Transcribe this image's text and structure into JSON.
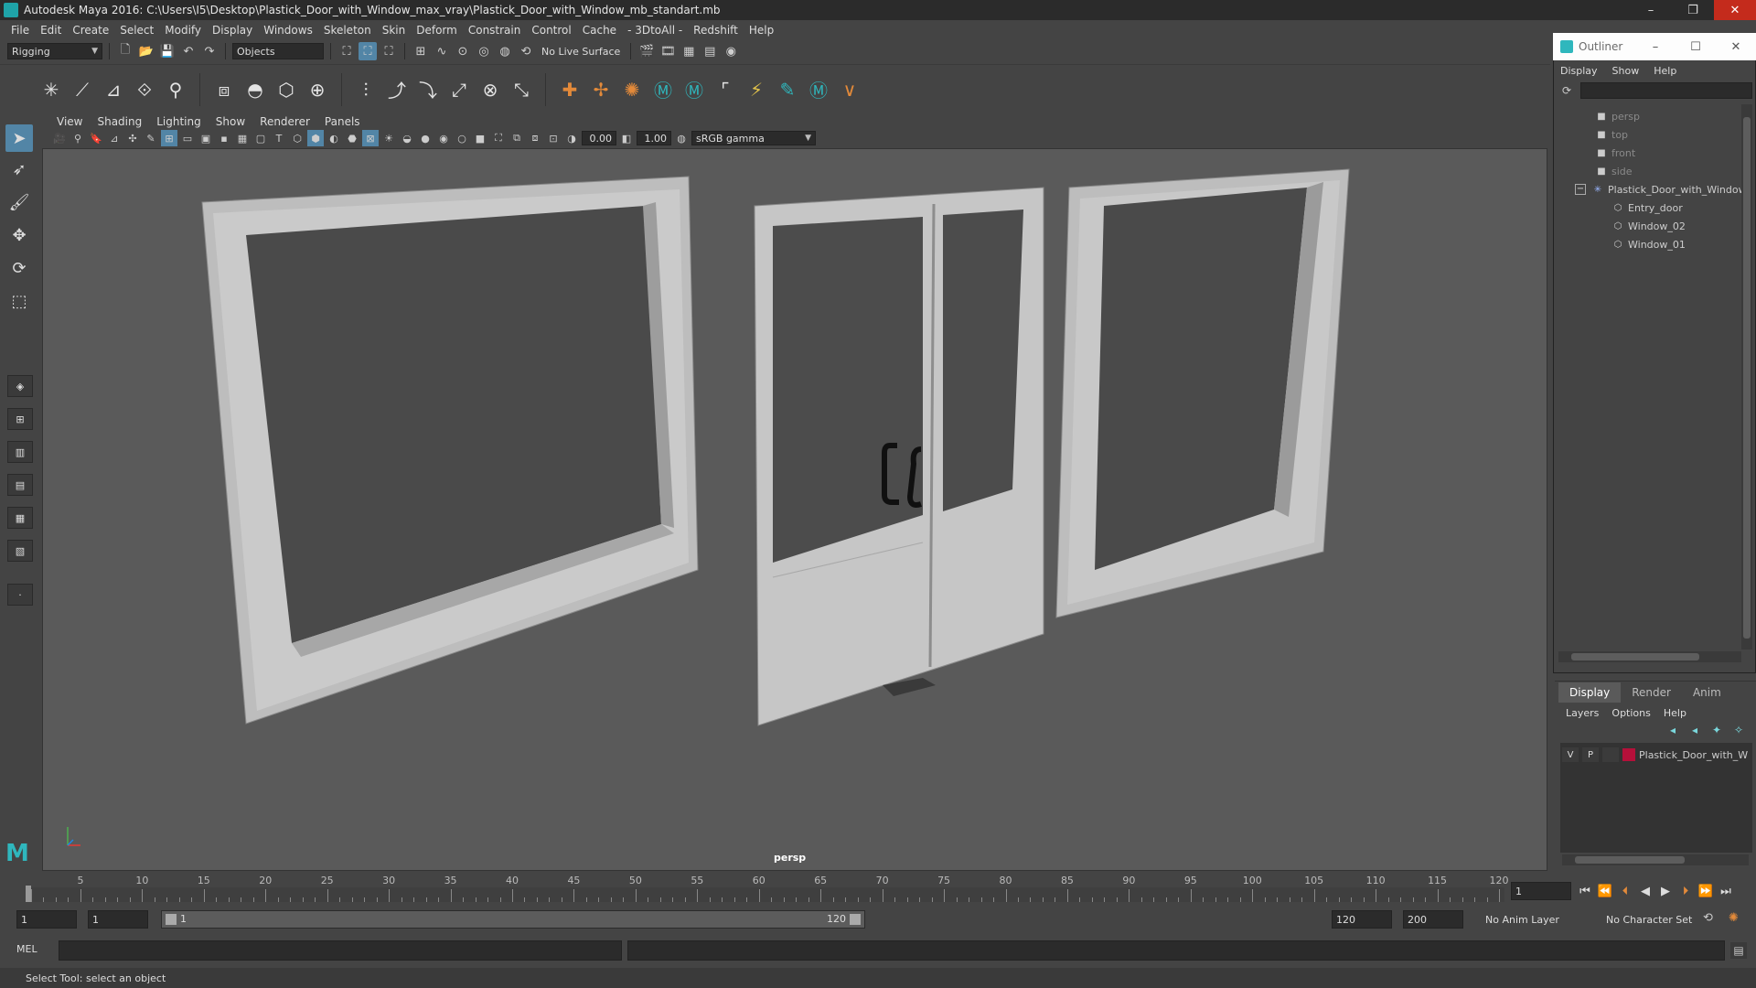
{
  "window": {
    "title": "Autodesk Maya 2016: C:\\Users\\I5\\Desktop\\Plastick_Door_with_Window_max_vray\\Plastick_Door_with_Window_mb_standart.mb",
    "minimize": "–",
    "restore": "❐",
    "close": "✕"
  },
  "menubar": [
    "File",
    "Edit",
    "Create",
    "Select",
    "Modify",
    "Display",
    "Windows",
    "Skeleton",
    "Skin",
    "Deform",
    "Constrain",
    "Control",
    "Cache",
    "- 3DtoAll -",
    "Redshift",
    "Help"
  ],
  "statusline": {
    "menuset": "Rigging",
    "selection_mode": "Objects",
    "live_surface": "No Live Surface"
  },
  "panel": {
    "menus": [
      "View",
      "Shading",
      "Lighting",
      "Show",
      "Renderer",
      "Panels"
    ],
    "exposure": "0.00",
    "gamma": "1.00",
    "color_space": "sRGB gamma",
    "camera": "persp"
  },
  "timeline": {
    "ticks": [
      "1",
      "5",
      "10",
      "15",
      "20",
      "25",
      "30",
      "35",
      "40",
      "45",
      "50",
      "55",
      "60",
      "65",
      "70",
      "75",
      "80",
      "85",
      "90",
      "95",
      "100",
      "105",
      "110",
      "115",
      "120"
    ],
    "current_frame": "1"
  },
  "range": {
    "start": "1",
    "playback_start": "1",
    "slider_start": "1",
    "slider_end": "120",
    "playback_end": "120",
    "end": "200",
    "anim_layer": "No Anim Layer",
    "character_set": "No Character Set"
  },
  "cmdline": {
    "label": "MEL"
  },
  "helpline": "Select Tool: select an object",
  "outliner": {
    "title": "Outliner",
    "menus": [
      "Display",
      "Show",
      "Help"
    ],
    "items": [
      {
        "label": "persp",
        "type": "camera"
      },
      {
        "label": "top",
        "type": "camera"
      },
      {
        "label": "front",
        "type": "camera"
      },
      {
        "label": "side",
        "type": "camera"
      },
      {
        "label": "Plastick_Door_with_Window",
        "type": "group"
      },
      {
        "label": "Entry_door",
        "type": "mesh"
      },
      {
        "label": "Window_02",
        "type": "mesh"
      },
      {
        "label": "Window_01",
        "type": "mesh"
      }
    ]
  },
  "layer_editor": {
    "tabs": [
      "Display",
      "Render",
      "Anim"
    ],
    "menus": [
      "Layers",
      "Options",
      "Help"
    ],
    "layer": {
      "v": "V",
      "p": "P",
      "name": "Plastick_Door_with_W",
      "color": "#b5103a"
    }
  }
}
